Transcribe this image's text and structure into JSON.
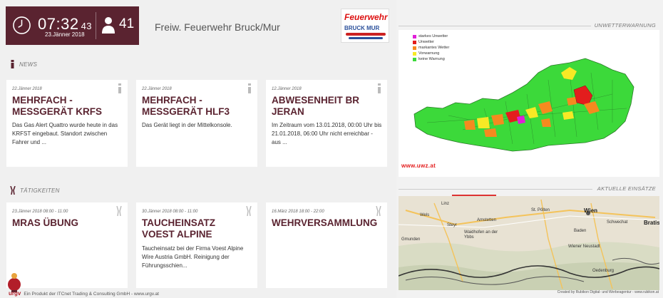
{
  "header": {
    "time_main": "07:32",
    "time_seconds": "43",
    "date": "23.Jänner 2018",
    "count": "41",
    "org_name": "Freiw. Feuerwehr Bruck/Mur",
    "logo_text_top": "Feuerwehr",
    "logo_text_bottom": "BRUCK MUR"
  },
  "news": {
    "section_label": "NEWS",
    "cards": [
      {
        "date": "22.Jänner 2018",
        "title": "MEHRFACH - MESSGERÄT KRFS",
        "text": "Das Gas Alert Quattro wurde heute in das KRFST eingebaut. Standort zwischen Fahrer und ..."
      },
      {
        "date": "22.Jänner 2018",
        "title": "MEHRFACH - MESSGERÄT HLF3",
        "text": "Das Gerät liegt in der Mittelkonsole."
      },
      {
        "date": "12.Jänner 2018",
        "title": "ABWESENHEIT BR JERAN",
        "text": "Im Zeitraum vom 13.01.2018, 00:00 Uhr bis 21.01.2018, 06:00 Uhr nicht erreichbar - aus ..."
      }
    ]
  },
  "activities": {
    "section_label": "TÄTIGKEITEN",
    "cards": [
      {
        "date": "23.Jänner 2018 08:00 - 11:00",
        "title": "MRAS ÜBUNG",
        "text": ""
      },
      {
        "date": "30.Jänner 2018 08:00 - 11:00",
        "title": "TAUCHEINSATZ VOEST ALPINE",
        "text": "Taucheinsatz bei der Firma Voest Alpine Wire Austria GmbH. Reinigung der Führungsschien..."
      },
      {
        "date": "16.März 2018 18:00 - 22:00",
        "title": "WEHRVERSAMMLUNG",
        "text": ""
      }
    ]
  },
  "footer": {
    "brand": "urgv",
    "text": "Ein Produkt der ITCnet Trading & Consulting GmbH - www.urgv.at"
  },
  "weather": {
    "panel_label": "UNWETTERWARNUNG",
    "legend": [
      {
        "label": "starkes Unwetter",
        "color": "#e01fd8"
      },
      {
        "label": "Unwetter",
        "color": "#e31d1d"
      },
      {
        "label": "markantes Wetter",
        "color": "#f58a1f"
      },
      {
        "label": "Vorwarnung",
        "color": "#f7e925"
      },
      {
        "label": "keine Warnung",
        "color": "#3cd93a"
      }
    ],
    "source": "www.uwz.at"
  },
  "operations": {
    "panel_label": "AKTUELLE EINSÄTZE",
    "cities": [
      "Linz",
      "Wels",
      "Amstetten",
      "St. Pölten",
      "Wien",
      "Bratis",
      "Steyr",
      "Waidhofen an der Ybbs",
      "Schwechat",
      "Baden",
      "Wiener Neustadt",
      "Gmunden",
      "Oedenburg"
    ],
    "credits": "Created by Rubikon Digital- und Werbeagentur - www.rubikon.at"
  },
  "colors": {
    "brand": "#5a2330",
    "title": "#5a2330",
    "warning_green": "#3cd93a"
  }
}
